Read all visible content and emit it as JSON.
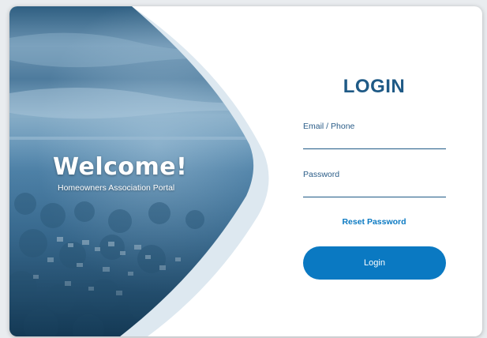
{
  "hero": {
    "welcome": "Welcome!",
    "subtitle": "Homeowners Association Portal"
  },
  "login": {
    "title": "LOGIN",
    "email_label": "Email / Phone",
    "email_value": "",
    "password_label": "Password",
    "password_value": "",
    "reset_label": "Reset Password",
    "button_label": "Login"
  },
  "colors": {
    "primary": "#0a79c2",
    "title": "#1f5a86",
    "hero_tint": "#3b7aa6"
  }
}
